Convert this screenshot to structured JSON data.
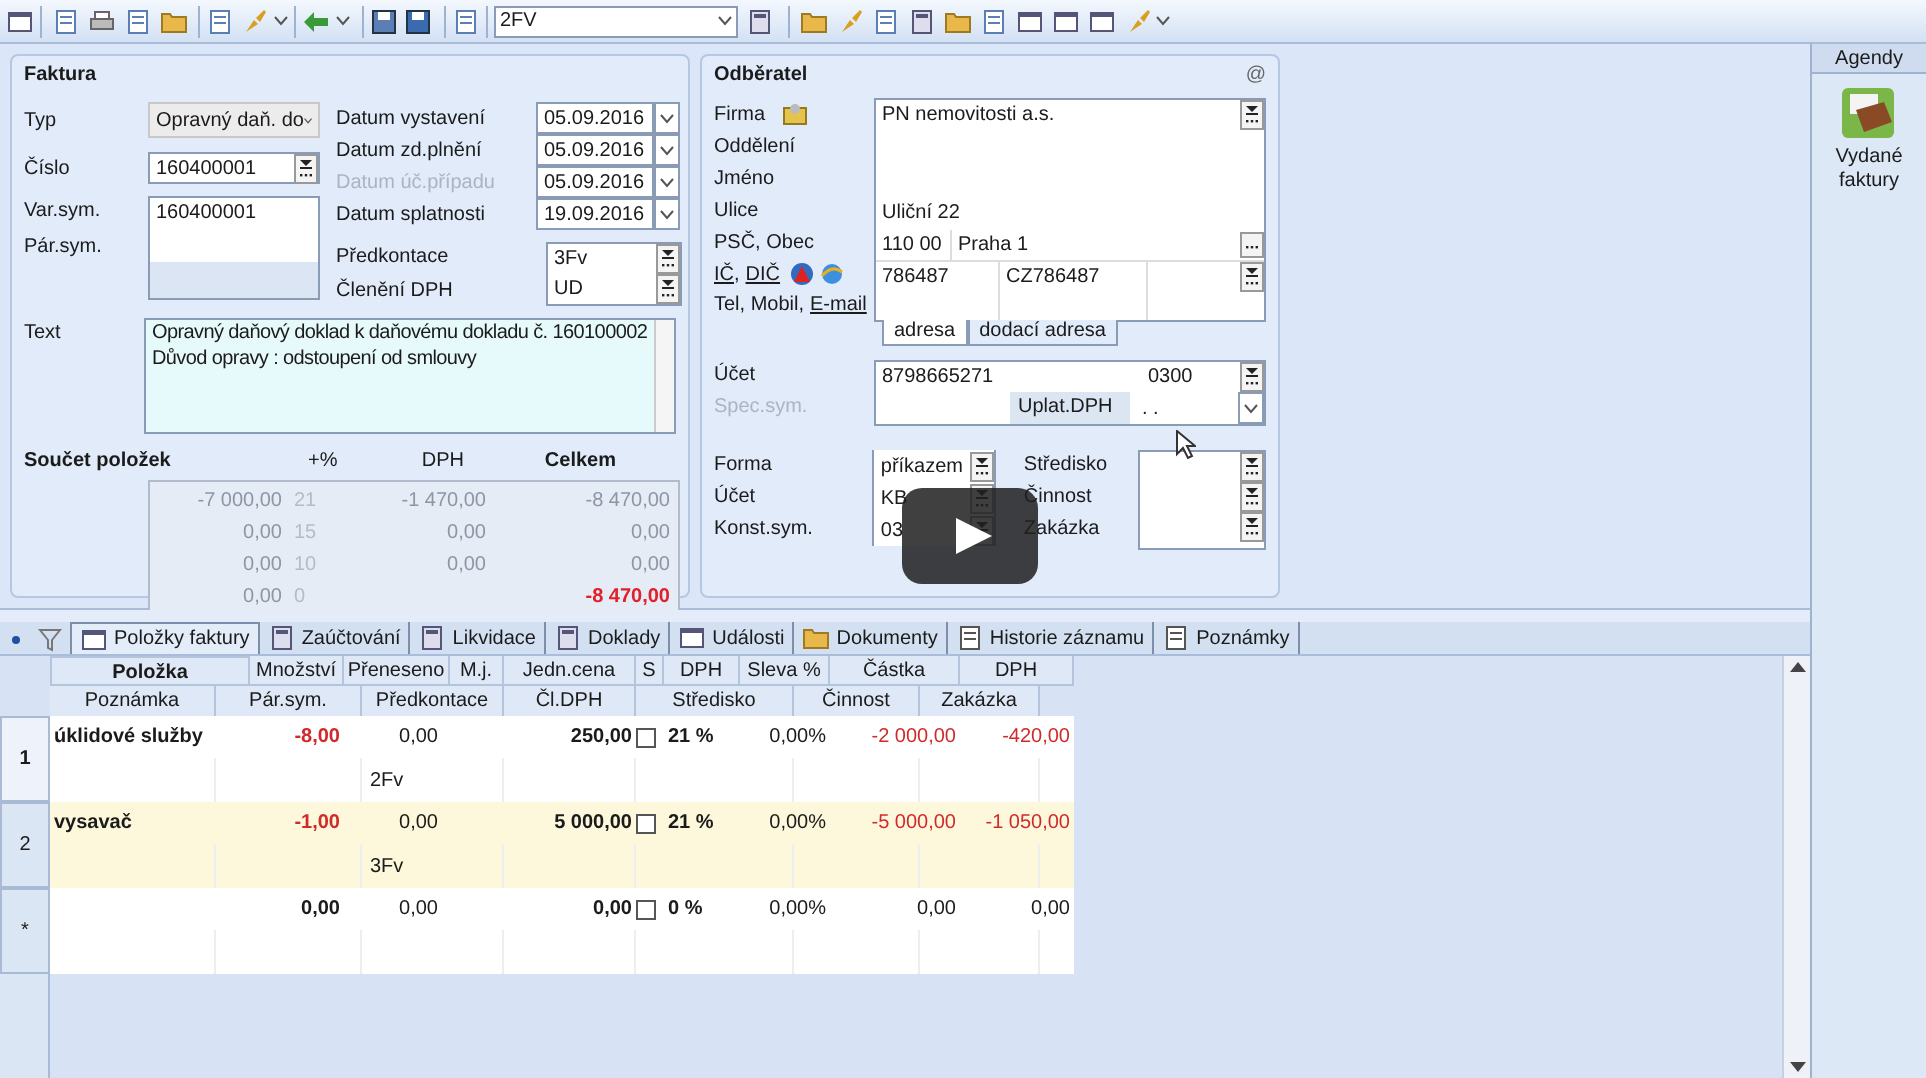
{
  "toolbar": {
    "combo_value": "2FV"
  },
  "faktura": {
    "title": "Faktura",
    "typ": {
      "label": "Typ",
      "value": "Opravný daň. do"
    },
    "cislo": {
      "label": "Číslo",
      "value": "160400001"
    },
    "var_sym": {
      "label": "Var.sym.",
      "value": "160400001"
    },
    "par_sym": {
      "label": "Pár.sym."
    },
    "dates": [
      {
        "label": "Datum vystavení",
        "value": "05.09.2016",
        "disabled": false
      },
      {
        "label": "Datum zd.plnění",
        "value": "05.09.2016",
        "disabled": false
      },
      {
        "label": "Datum úč.případu",
        "value": "05.09.2016",
        "disabled": true
      },
      {
        "label": "Datum splatnosti",
        "value": "19.09.2016",
        "disabled": false
      }
    ],
    "predkontace": {
      "label": "Předkontace",
      "value": "3Fv"
    },
    "cleneni": {
      "label": "Členění DPH",
      "value": "UD"
    },
    "text": {
      "label": "Text",
      "value": "Opravný daňový doklad k daňovému dokladu č. 160100002\nDůvod opravy : odstoupení od smlouvy"
    },
    "totals": {
      "title": "Součet položek",
      "columns": [
        "+%",
        "DPH",
        "Celkem"
      ],
      "rows": [
        {
          "base": "-7 000,00",
          "rate": "21",
          "dph": "-1 470,00",
          "total": "-8 470,00",
          "kind": "rate"
        },
        {
          "base": "0,00",
          "rate": "15",
          "dph": "0,00",
          "total": "0,00",
          "kind": "rate"
        },
        {
          "base": "0,00",
          "rate": "10",
          "dph": "0,00",
          "total": "0,00",
          "kind": "rate"
        },
        {
          "base": "0,00",
          "rate": "0",
          "total": "-8 470,00",
          "kind": "grand"
        }
      ]
    }
  },
  "odberatel": {
    "title": "Odběratel",
    "corner": "@",
    "labels": [
      "Firma",
      "Oddělení",
      "Jméno",
      "Ulice",
      "PSČ, Obec"
    ],
    "ic_link": "IČ",
    "separator": ",",
    "dic_link": "DIČ",
    "contact_text": "Tel, Mobil,",
    "email_link": "E-mail",
    "firma": "PN nemovitosti a.s.",
    "ulice": "Uliční 22",
    "psc": "110 00",
    "obec": "Praha 1",
    "ic": "786487",
    "dic": "CZ786487",
    "tabs": [
      {
        "label": "adresa",
        "selected": true
      },
      {
        "label": "dodací adresa",
        "selected": false
      }
    ],
    "ucet": {
      "label": "Účet",
      "value": "8798665271",
      "bank": "0300"
    },
    "spec_sym": {
      "label": "Spec.sym.",
      "disabled": true
    },
    "uplat": {
      "label": "Uplat.DPH",
      "value": ". ."
    },
    "payment": [
      {
        "label": "Forma",
        "value": "příkazem"
      },
      {
        "label": "Účet",
        "value": "KB"
      },
      {
        "label": "Konst.sym.",
        "value": "03"
      }
    ],
    "assign": [
      "Středisko",
      "Činnost",
      "Zakázka"
    ]
  },
  "sidebar": {
    "title": "Agendy",
    "item": "Vydané faktury"
  },
  "bottom_tabs": [
    {
      "label": "Položky faktury",
      "selected": true
    },
    {
      "label": "Zaúčtování",
      "selected": false
    },
    {
      "label": "Likvidace",
      "selected": false
    },
    {
      "label": "Doklady",
      "selected": false
    },
    {
      "label": "Události",
      "selected": false
    },
    {
      "label": "Dokumenty",
      "selected": false
    },
    {
      "label": "Historie záznamu",
      "selected": false
    },
    {
      "label": "Poznámky",
      "selected": false
    }
  ],
  "grid": {
    "header_1": [
      "Položka",
      "Množství",
      "Přeneseno",
      "M.j.",
      "Jedn.cena",
      "S",
      "DPH",
      "Sleva %",
      "Částka",
      "DPH"
    ],
    "header_2": [
      "Poznámka",
      "Pár.sym.",
      "Předkontace",
      "Čl.DPH",
      "Středisko",
      "Činnost",
      "Zakázka"
    ],
    "rows": [
      {
        "number": "1",
        "kind": "item",
        "current": true,
        "selected": false,
        "polozka": "úklidové služby",
        "mnozstvi": "-8,00",
        "preneseno": "0,00",
        "jedn_cena": "250,00",
        "s": false,
        "dph": "21 %",
        "sleva": "0,00%",
        "castka": "-2 000,00",
        "dph_castka": "-420,00",
        "predkontace": "2Fv"
      },
      {
        "number": "2",
        "kind": "item",
        "current": false,
        "selected": true,
        "polozka": "vysavač",
        "mnozstvi": "-1,00",
        "preneseno": "0,00",
        "jedn_cena": "5 000,00",
        "s": false,
        "dph": "21 %",
        "sleva": "0,00%",
        "castka": "-5 000,00",
        "dph_castka": "-1 050,00",
        "predkontace": "3Fv"
      },
      {
        "number": "*",
        "kind": "new",
        "current": false,
        "selected": false,
        "mnozstvi": "0,00",
        "preneseno": "0,00",
        "jedn_cena": "0,00",
        "s": false,
        "dph": "0 %",
        "sleva": "0,00%",
        "castka": "0,00",
        "dph_castka": "0,00"
      }
    ]
  }
}
